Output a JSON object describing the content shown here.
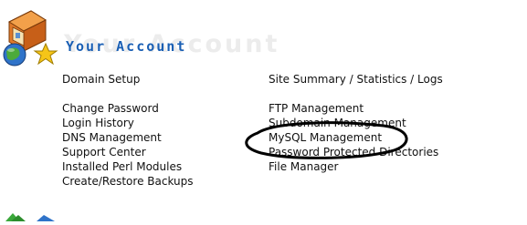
{
  "header": {
    "title": "Your Account",
    "title_shadow": "Your Account",
    "accent_color": "#1a5fb4"
  },
  "icons": {
    "logo": "house-globe-star-icon",
    "bottom": "arrow-icons"
  },
  "left_column": [
    {
      "label": "Domain Setup"
    },
    {
      "label": "Change Password"
    },
    {
      "label": "Login History"
    },
    {
      "label": "DNS Management"
    },
    {
      "label": "Support Center"
    },
    {
      "label": "Installed Perl Modules"
    },
    {
      "label": "Create/Restore Backups"
    }
  ],
  "right_column": [
    {
      "label": "Site Summary / Statistics / Logs"
    },
    {
      "label": "FTP Management"
    },
    {
      "label": "Subdomain Management"
    },
    {
      "label": "MySQL Management",
      "circled": true
    },
    {
      "label": "Password Protected Directories"
    },
    {
      "label": "File Manager"
    }
  ]
}
